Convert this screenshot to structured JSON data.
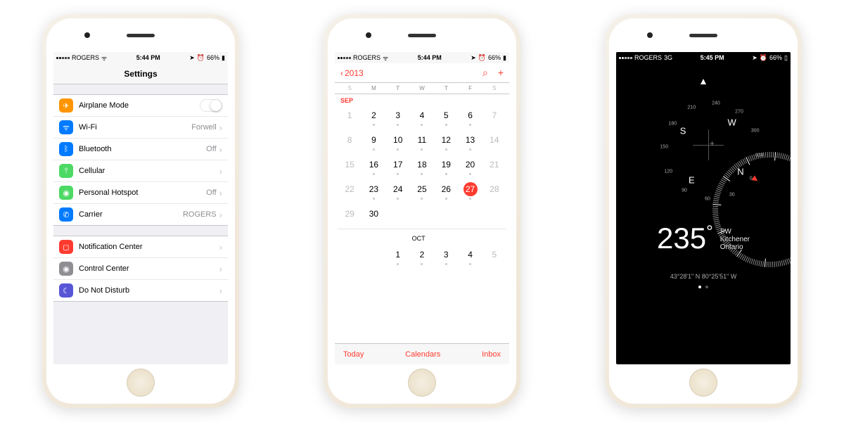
{
  "statusbar": {
    "carrier": "ROGERS",
    "carrier_tech": "3G",
    "time_1": "5:44 PM",
    "time_2": "5:45 PM",
    "battery": "66%"
  },
  "settings": {
    "title": "Settings",
    "group1": [
      {
        "icon": "airplane",
        "color": "ic-orange",
        "glyph": "✈",
        "label": "Airplane Mode",
        "value": "",
        "toggle": true
      },
      {
        "icon": "wifi",
        "color": "ic-blue",
        "glyph": "ᯤ",
        "label": "Wi-Fi",
        "value": "Forwell"
      },
      {
        "icon": "bluetooth",
        "color": "ic-blue",
        "glyph": "ᛒ",
        "label": "Bluetooth",
        "value": "Off"
      },
      {
        "icon": "cellular",
        "color": "ic-green",
        "glyph": "⫯",
        "label": "Cellular",
        "value": ""
      },
      {
        "icon": "hotspot",
        "color": "ic-green",
        "glyph": "◉",
        "label": "Personal Hotspot",
        "value": "Off"
      },
      {
        "icon": "carrier",
        "color": "ic-blue",
        "glyph": "✆",
        "label": "Carrier",
        "value": "ROGERS"
      }
    ],
    "group2": [
      {
        "icon": "notification",
        "color": "ic-red",
        "glyph": "◻",
        "label": "Notification Center",
        "value": ""
      },
      {
        "icon": "control",
        "color": "ic-gray",
        "glyph": "◉",
        "label": "Control Center",
        "value": ""
      },
      {
        "icon": "dnd",
        "color": "ic-purple",
        "glyph": "☾",
        "label": "Do Not Disturb",
        "value": ""
      }
    ]
  },
  "calendar": {
    "back": "2013",
    "dow": [
      "S",
      "M",
      "T",
      "W",
      "T",
      "F",
      "S"
    ],
    "month": "SEP",
    "weeks": [
      [
        {
          "n": "1",
          "w": true
        },
        {
          "n": "2",
          "d": true
        },
        {
          "n": "3",
          "d": true
        },
        {
          "n": "4",
          "d": true
        },
        {
          "n": "5",
          "d": true
        },
        {
          "n": "6",
          "d": true
        },
        {
          "n": "7",
          "w": true
        }
      ],
      [
        {
          "n": "8",
          "w": true
        },
        {
          "n": "9",
          "d": true
        },
        {
          "n": "10",
          "d": true
        },
        {
          "n": "11",
          "d": true
        },
        {
          "n": "12",
          "d": true
        },
        {
          "n": "13",
          "d": true
        },
        {
          "n": "14",
          "w": true
        }
      ],
      [
        {
          "n": "15",
          "w": true
        },
        {
          "n": "16",
          "d": true
        },
        {
          "n": "17",
          "d": true
        },
        {
          "n": "18",
          "d": true
        },
        {
          "n": "19",
          "d": true
        },
        {
          "n": "20",
          "d": true
        },
        {
          "n": "21",
          "w": true
        }
      ],
      [
        {
          "n": "22",
          "w": true
        },
        {
          "n": "23",
          "d": true
        },
        {
          "n": "24",
          "d": true
        },
        {
          "n": "25",
          "d": true
        },
        {
          "n": "26",
          "d": true
        },
        {
          "n": "27",
          "d": true,
          "today": true
        },
        {
          "n": "28",
          "w": true
        }
      ],
      [
        {
          "n": "29",
          "w": true
        },
        {
          "n": "30"
        },
        {
          "n": ""
        },
        {
          "n": ""
        },
        {
          "n": ""
        },
        {
          "n": ""
        },
        {
          "n": ""
        }
      ]
    ],
    "next_month": "OCT",
    "oct_week": [
      {
        "n": ""
      },
      {
        "n": ""
      },
      {
        "n": "1",
        "d": true
      },
      {
        "n": "2",
        "d": true
      },
      {
        "n": "3",
        "d": true
      },
      {
        "n": "4",
        "d": true
      },
      {
        "n": "5",
        "w": true
      }
    ],
    "toolbar": {
      "today": "Today",
      "cal": "Calendars",
      "inbox": "Inbox"
    }
  },
  "compass": {
    "cardinals": {
      "N": "N",
      "E": "E",
      "S": "S",
      "W": "W"
    },
    "degree_labels": [
      "0",
      "30",
      "60",
      "90",
      "120",
      "150",
      "180",
      "210",
      "240",
      "270",
      "300",
      "330"
    ],
    "heading": "235",
    "heading_dir": "SW",
    "city": "Kitchener",
    "region": "Ontario",
    "coords": "43°28'1\" N  80°25'51\" W"
  }
}
